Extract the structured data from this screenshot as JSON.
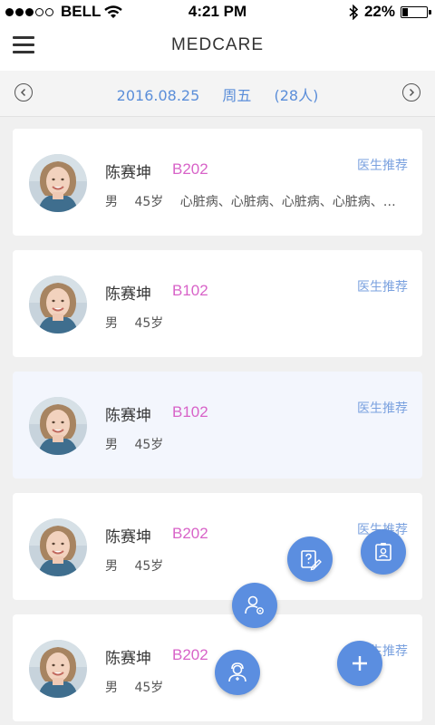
{
  "status_bar": {
    "carrier": "BELL",
    "time": "4:21 PM",
    "battery": "22%",
    "battery_level": 0.22
  },
  "header": {
    "title": "MEDCARE",
    "menu_icon": "hamburger-menu-icon"
  },
  "date_bar": {
    "date": "2016.08.25",
    "weekday": "周五",
    "count": "(28人)"
  },
  "patients": [
    {
      "name": "陈赛坤",
      "bed": "B202",
      "gender": "男",
      "age": "45岁",
      "diseases": "心脏病、心脏病、心脏病、心脏病、心脏病",
      "tag": "医生推荐"
    },
    {
      "name": "陈赛坤",
      "bed": "B102",
      "gender": "男",
      "age": "45岁",
      "diseases": "",
      "tag": "医生推荐"
    },
    {
      "name": "陈赛坤",
      "bed": "B102",
      "gender": "男",
      "age": "45岁",
      "diseases": "",
      "tag": "医生推荐",
      "highlighted": true
    },
    {
      "name": "陈赛坤",
      "bed": "B202",
      "gender": "男",
      "age": "45岁",
      "diseases": "",
      "tag": "医生推荐"
    },
    {
      "name": "陈赛坤",
      "bed": "B202",
      "gender": "男",
      "age": "45岁",
      "diseases": "",
      "tag": "医生推荐"
    }
  ],
  "fab_menu": {
    "color": "#5b8ee0",
    "items": [
      "question-edit-icon",
      "contact-card-icon",
      "user-settings-icon",
      "doctor-icon",
      "plus-icon"
    ]
  }
}
